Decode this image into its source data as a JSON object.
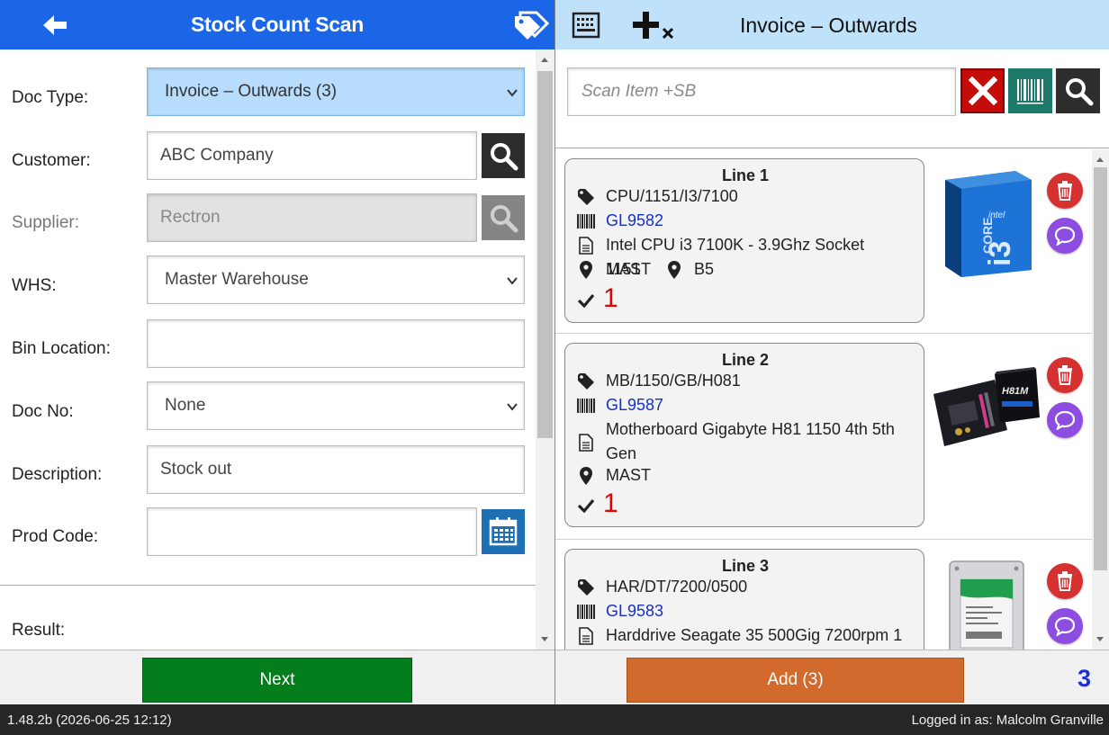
{
  "left": {
    "title": "Stock Count Scan",
    "form": {
      "doc_type_label": "Doc Type:",
      "doc_type_value": "Invoice – Outwards (3)",
      "customer_label": "Customer:",
      "customer_value": "ABC Company",
      "supplier_label": "Supplier:",
      "supplier_value": "Rectron",
      "whs_label": "WHS:",
      "whs_value": "Master Warehouse",
      "bin_label": "Bin Location:",
      "bin_value": "",
      "doc_no_label": "Doc No:",
      "doc_no_value": "None",
      "description_label": "Description:",
      "description_value": "Stock out",
      "prod_code_label": "Prod Code:",
      "prod_code_value": "",
      "result_label": "Result:"
    },
    "next_label": "Next"
  },
  "right": {
    "title": "Invoice – Outwards",
    "scan_placeholder": "Scan Item +SB",
    "lines": [
      {
        "title": "Line 1",
        "code": "CPU/1151/I3/7100",
        "barcode": "GL9582",
        "description": "Intel CPU i3 7100K - 3.9Ghz Socket 1151",
        "location": "MAST",
        "bin": "B5",
        "qty": "1",
        "image_icon": "cpu-box-image"
      },
      {
        "title": "Line 2",
        "code": "MB/1150/GB/H081",
        "barcode": "GL9587",
        "description": "Motherboard Gigabyte H81 1150 4th 5th Gen",
        "location": "MAST",
        "qty": "1",
        "image_icon": "motherboard-image"
      },
      {
        "title": "Line 3",
        "code": "HAR/DT/7200/0500",
        "barcode": "GL9583",
        "description": "Harddrive Seagate 35 500Gig 7200rpm 1",
        "image_icon": "harddrive-image"
      }
    ],
    "add_label": "Add (3)",
    "count": "3"
  },
  "status": {
    "version": "1.48.2b (2026-06-25 12:12)",
    "logged_in": "Logged in as: Malcolm Granville"
  },
  "colors": {
    "left_header": "#1a66e6",
    "right_header": "#bfe1fa",
    "next_button": "#047d1c",
    "add_button": "#d36a2d",
    "qty_red": "#e80000",
    "barcode_blue": "#1530c8"
  }
}
